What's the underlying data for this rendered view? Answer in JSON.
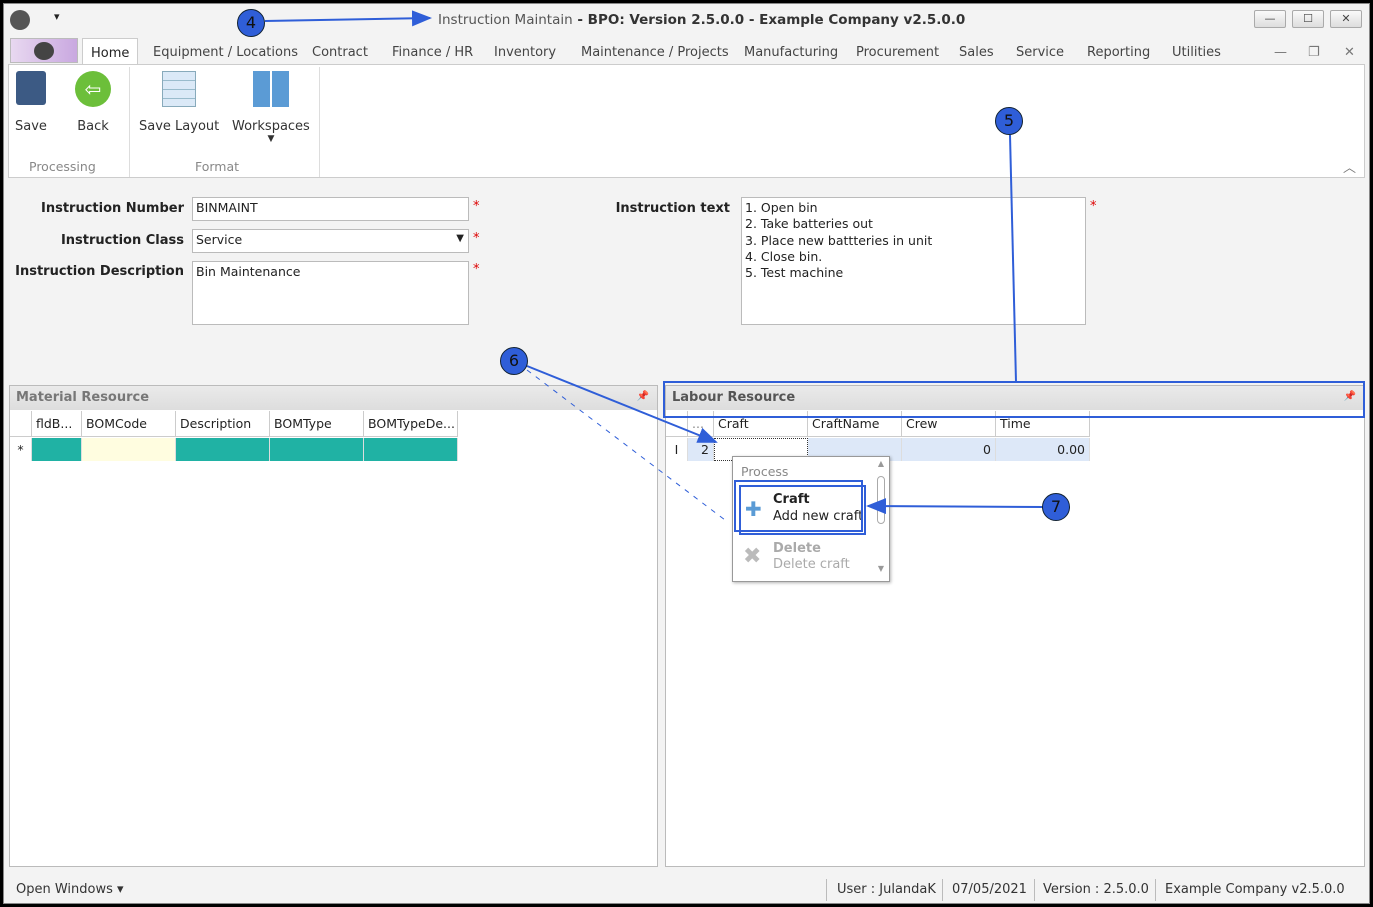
{
  "window": {
    "title_prefix": "Instruction Maintain",
    "title_rest": " - BPO: Version 2.5.0.0 - Example Company v2.5.0.0",
    "minimize": "—",
    "maximize": "☐",
    "close": "✕"
  },
  "tabs": [
    "Home",
    "Equipment / Locations",
    "Contract",
    "Finance / HR",
    "Inventory",
    "Maintenance / Projects",
    "Manufacturing",
    "Procurement",
    "Sales",
    "Service",
    "Reporting",
    "Utilities"
  ],
  "ribbon": {
    "save": "Save",
    "back": "Back",
    "save_layout": "Save Layout",
    "workspaces": "Workspaces",
    "group_processing": "Processing",
    "group_format": "Format"
  },
  "form": {
    "instruction_number_label": "Instruction Number",
    "instruction_number": "BINMAINT",
    "instruction_class_label": "Instruction Class",
    "instruction_class": "Service",
    "instruction_description_label": "Instruction Description",
    "instruction_description": "Bin Maintenance",
    "instruction_text_label": "Instruction text",
    "instruction_text": "1. Open bin\n2. Take batteries out\n3. Place new battteries in unit\n4. Close bin.\n5. Test machine",
    "required": "*"
  },
  "material": {
    "title": "Material Resource",
    "columns": [
      "fldB...",
      "BOMCode",
      "Description",
      "BOMType",
      "BOMTypeDe..."
    ],
    "new_row_marker": "*"
  },
  "labour": {
    "title": "Labour Resource",
    "columns": [
      "...",
      "Craft",
      "CraftName",
      "Crew",
      "Time"
    ],
    "row": {
      "indicator": "I",
      "num": "2",
      "craft": "",
      "craftname": "",
      "crew": "0",
      "time": "0.00"
    }
  },
  "context_menu": {
    "header": "Process",
    "items": [
      {
        "title": "Craft",
        "subtitle": "Add new craft",
        "enabled": true
      },
      {
        "title": "Delete",
        "subtitle": "Delete craft",
        "enabled": false
      }
    ]
  },
  "status": {
    "open_windows": "Open Windows",
    "user": "User : JulandaK",
    "date": "07/05/2021",
    "version": "Version : 2.5.0.0",
    "company": "Example Company v2.5.0.0"
  },
  "annotations": [
    "4",
    "5",
    "6",
    "7"
  ],
  "colors": {
    "accent": "#2f5ed8",
    "teal": "#20b2a4",
    "cell_yellow": "#fffde0",
    "selected_row": "#dde8f8"
  }
}
